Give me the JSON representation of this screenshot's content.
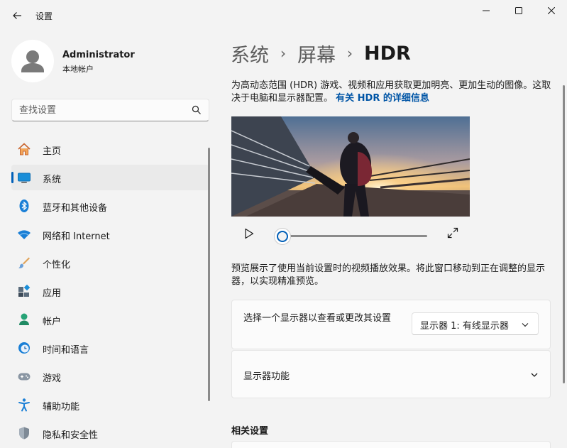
{
  "app": {
    "title": "设置",
    "back_icon": "back-arrow-icon"
  },
  "window_controls": {
    "minimize_icon": "minimize-icon",
    "maximize_icon": "maximize-icon",
    "close_icon": "close-icon"
  },
  "user": {
    "name": "Administrator",
    "account_type": "本地帐户"
  },
  "search": {
    "placeholder": "查找设置",
    "icon": "search-icon"
  },
  "sidebar": {
    "items": [
      {
        "label": "主页",
        "icon": "home-icon",
        "active": false
      },
      {
        "label": "系统",
        "icon": "system-display-icon",
        "active": true
      },
      {
        "label": "蓝牙和其他设备",
        "icon": "bluetooth-icon",
        "active": false
      },
      {
        "label": "网络和 Internet",
        "icon": "wifi-icon",
        "active": false
      },
      {
        "label": "个性化",
        "icon": "paintbrush-icon",
        "active": false
      },
      {
        "label": "应用",
        "icon": "apps-icon",
        "active": false
      },
      {
        "label": "帐户",
        "icon": "account-icon",
        "active": false
      },
      {
        "label": "时间和语言",
        "icon": "time-language-icon",
        "active": false
      },
      {
        "label": "游戏",
        "icon": "gamepad-icon",
        "active": false
      },
      {
        "label": "辅助功能",
        "icon": "accessibility-icon",
        "active": false
      },
      {
        "label": "隐私和安全性",
        "icon": "shield-icon",
        "active": false
      }
    ]
  },
  "breadcrumb": {
    "items": [
      "系统",
      "屏幕"
    ],
    "current": "HDR"
  },
  "main": {
    "description": "为高动态范围 (HDR) 游戏、视频和应用获取更加明亮、更加生动的图像。这取决于电脑和显示器配置。",
    "learn_more_link": "有关 HDR 的详细信息",
    "preview_note": "预览展示了使用当前设置时的视频播放效果。将此窗口移动到正在调整的显示器，以实现精准预览。",
    "video_progress": 0,
    "display_selector": {
      "label": "选择一个显示器以查看或更改其设置",
      "selected": "显示器 1: 有线显示器"
    },
    "display_features": {
      "label": "显示器功能"
    },
    "related_settings_title": "相关设置"
  },
  "colors": {
    "accent": "#005fb8",
    "link": "#0055a6",
    "background": "#f3f3f3",
    "card": "#fbfbfb"
  }
}
